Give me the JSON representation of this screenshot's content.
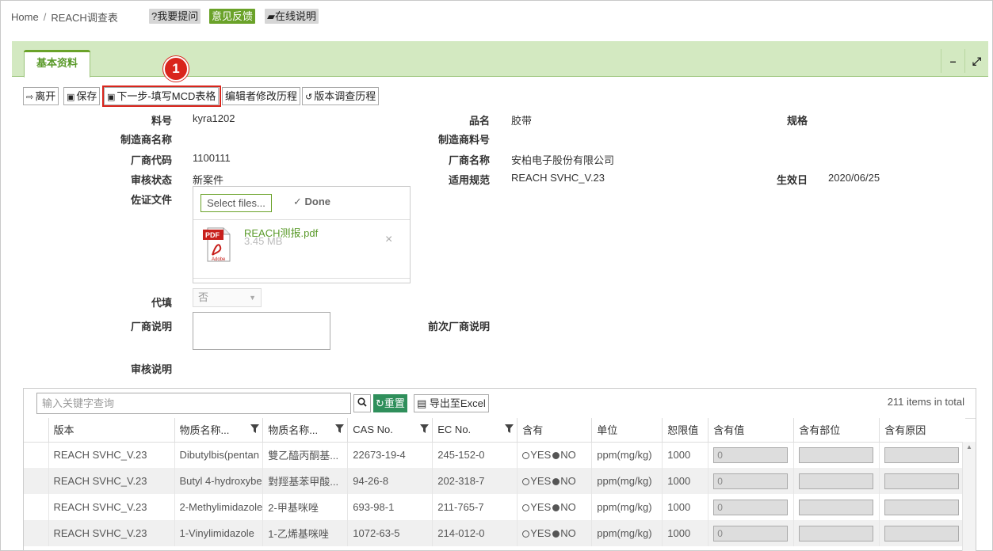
{
  "breadcrumb": {
    "home": "Home",
    "separator": "/",
    "current": "REACH调查表"
  },
  "header_buttons": {
    "ask": "?我要提问",
    "feedback": "意见反馈",
    "manual": "在线说明"
  },
  "panel": {
    "tab_label": "基本资料",
    "minimize": "–",
    "expand": "⤢"
  },
  "toolbar": {
    "leave": "离开",
    "save": "保存",
    "next_step": "下一步-填写MCD表格",
    "edit_history": "编辑者修改历程",
    "version_history": "版本调查历程"
  },
  "callout": {
    "number": "1"
  },
  "form": {
    "part_no_label": "料号",
    "part_no": "kyra1202",
    "product_name_label": "品名",
    "product_name": "胶带",
    "spec_label": "规格",
    "mfr_name_label": "制造商名称",
    "mfr_part_label": "制造商料号",
    "vendor_code_label": "厂商代码",
    "vendor_code": "1100111",
    "vendor_name_label": "厂商名称",
    "vendor_name": "安柏电子股份有限公司",
    "review_status_label": "审核状态",
    "review_status": "新案件",
    "regulation_label": "适用规范",
    "regulation": "REACH SVHC_V.23",
    "effective_date_label": "生效日",
    "effective_date": "2020/06/25",
    "evidence_label": "佐证文件",
    "proxy_label": "代填",
    "proxy_value": "否",
    "vendor_note_label": "厂商说明",
    "prev_vendor_note_label": "前次厂商说明",
    "review_note_label": "审核说明"
  },
  "upload": {
    "select_button": "Select files...",
    "done_label": "Done",
    "file_name": "REACH测报.pdf",
    "file_size": "3.45 MB",
    "pdf_label": "PDF",
    "adobe_label": "Adobe",
    "remove": "×"
  },
  "grid": {
    "search_placeholder": "输入关键字查询",
    "reset_button": "重置",
    "export_button": "导出至Excel",
    "total": "211 items in total",
    "columns": [
      "版本",
      "物质名称...",
      "物质名称...",
      "CAS No.",
      "EC No.",
      "含有",
      "单位",
      "恕限值",
      "含有值",
      "含有部位",
      "含有原因"
    ],
    "yes_label": "YES",
    "no_label": "NO",
    "rows": [
      {
        "version": "REACH SVHC_V.23",
        "name_en": "Dibutylbis(pentan",
        "name_cn": "雙乙醯丙酮基...",
        "cas": "22673-19-4",
        "ec": "245-152-0",
        "unit": "ppm(mg/kg)",
        "limit": "1000",
        "value": "0"
      },
      {
        "version": "REACH SVHC_V.23",
        "name_en": "Butyl 4-hydroxybe",
        "name_cn": "對羥基苯甲酸...",
        "cas": "94-26-8",
        "ec": "202-318-7",
        "unit": "ppm(mg/kg)",
        "limit": "1000",
        "value": "0"
      },
      {
        "version": "REACH SVHC_V.23",
        "name_en": "2-Methylimidazole",
        "name_cn": "2-甲基咪唑",
        "cas": "693-98-1",
        "ec": "211-765-7",
        "unit": "ppm(mg/kg)",
        "limit": "1000",
        "value": "0"
      },
      {
        "version": "REACH SVHC_V.23",
        "name_en": "1-Vinylimidazole",
        "name_cn": "1-乙烯基咪唑",
        "cas": "1072-63-5",
        "ec": "214-012-0",
        "unit": "ppm(mg/kg)",
        "limit": "1000",
        "value": "0"
      }
    ]
  },
  "colors": {
    "accent_green": "#6aa229",
    "panel_bg": "#d3e9c1",
    "highlight_red": "#d9251c",
    "reset_green": "#2f8f5b"
  }
}
